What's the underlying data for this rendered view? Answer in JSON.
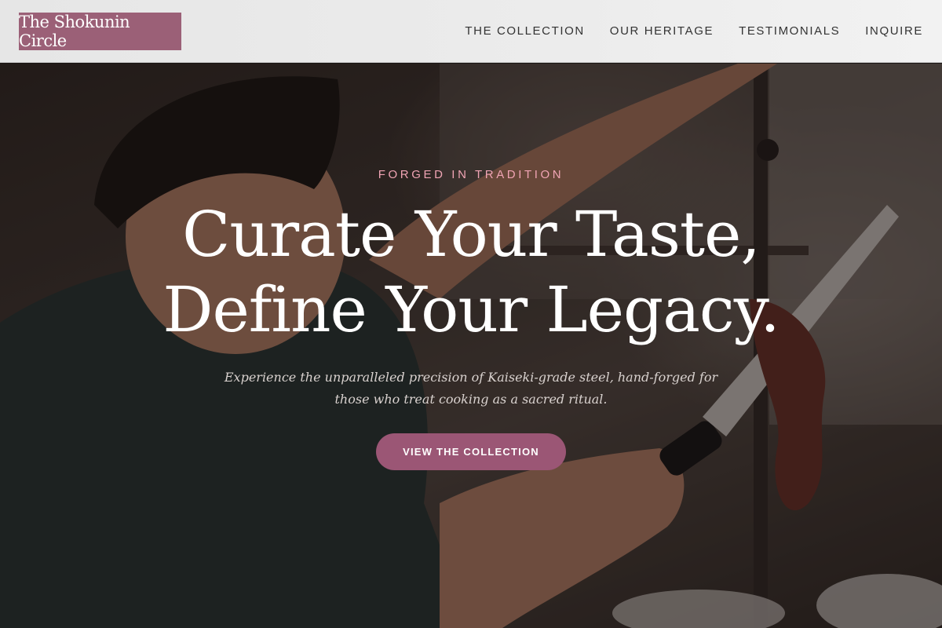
{
  "header": {
    "logo_text": "The Shokunin Circle",
    "nav": [
      {
        "label": "THE COLLECTION"
      },
      {
        "label": "OUR HERITAGE"
      },
      {
        "label": "TESTIMONIALS"
      },
      {
        "label": "INQUIRE"
      }
    ]
  },
  "hero": {
    "eyebrow": "FORGED IN TRADITION",
    "headline_line1": "Curate Your Taste,",
    "headline_line2": "Define Your Legacy.",
    "subtext": "Experience the unparalleled precision of Kaiseki-grade steel, hand-forged for those who treat cooking as a sacred ritual.",
    "cta_label": "VIEW THE COLLECTION"
  },
  "colors": {
    "brand": "#9b6077",
    "cta": "#9b5675",
    "eyebrow": "#f0a4b4"
  }
}
